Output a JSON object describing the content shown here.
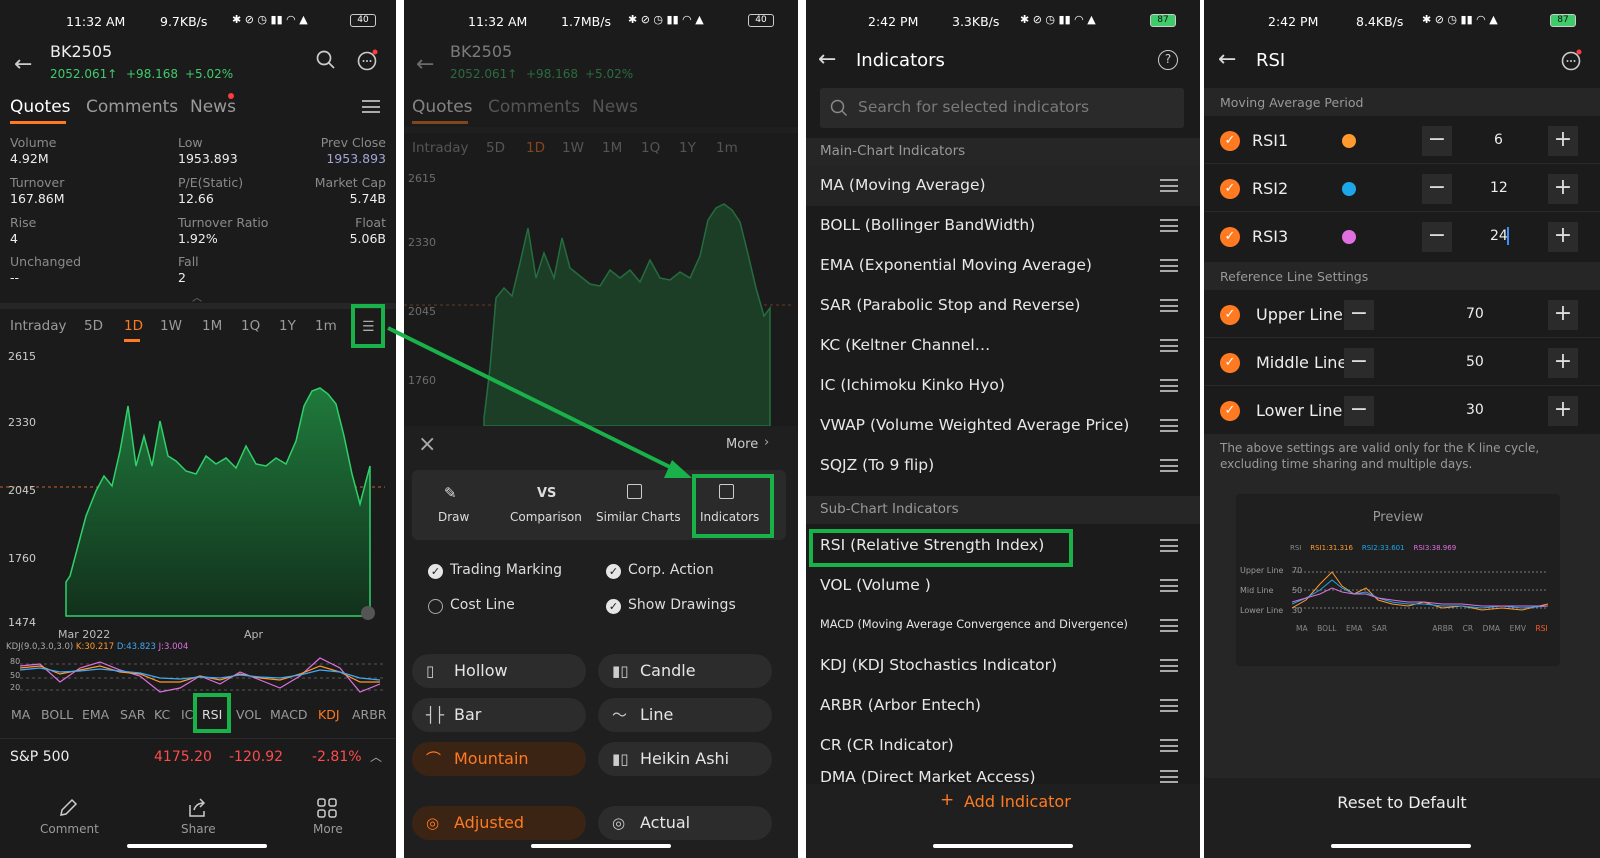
{
  "panel1": {
    "status": {
      "time": "11:32 AM",
      "speed": "9.7KB/s",
      "battery": "40"
    },
    "header": {
      "title": "BK2505",
      "price": "2052.061↑",
      "change": "+98.168",
      "pct": "+5.02%"
    },
    "tabs": [
      "Quotes",
      "Comments",
      "News"
    ],
    "stats": [
      {
        "label": "Volume",
        "value": "4.92M"
      },
      {
        "label": "Low",
        "value": "1953.893"
      },
      {
        "label": "Prev Close",
        "value": "1953.893"
      },
      {
        "label": "Turnover",
        "value": "167.86M"
      },
      {
        "label": "P/E(Static)",
        "value": "12.66"
      },
      {
        "label": "Market Cap",
        "value": "5.74B"
      },
      {
        "label": "Rise",
        "value": "4"
      },
      {
        "label": "Turnover Ratio",
        "value": "1.92%"
      },
      {
        "label": "Float",
        "value": "5.06B"
      },
      {
        "label": "Unchanged",
        "value": "--"
      },
      {
        "label": "Fall",
        "value": "2"
      }
    ],
    "periods": [
      "Intraday",
      "5D",
      "1D",
      "1W",
      "1M",
      "1Q",
      "1Y",
      "1m"
    ],
    "y_labels": [
      "2615",
      "2330",
      "2045",
      "1760",
      "1474"
    ],
    "x_labels": [
      "Mar 2022",
      "Apr"
    ],
    "kdj_legend": {
      "params": "KDJ(9.0,3.0,3.0)",
      "k": "K:30.217",
      "d": "D:43.823",
      "j": "J:3.004"
    },
    "kdj_levels": [
      "80",
      "50",
      "20"
    ],
    "indicators": [
      "MA",
      "BOLL",
      "EMA",
      "SAR",
      "KC",
      "IC",
      "RSI",
      "VOL",
      "MACD",
      "KDJ",
      "ARBR"
    ],
    "ticker": {
      "name": "S&P 500",
      "price": "4175.20",
      "change": "-120.92",
      "pct": "-2.81%"
    },
    "bottom": [
      "Comment",
      "Share",
      "More"
    ],
    "colors": {
      "up": "#3fca6b",
      "down": "#ff4b4b",
      "accent": "#ff7a20",
      "highlight": "#19b24a"
    }
  },
  "panel2": {
    "status": {
      "time": "11:32 AM",
      "speed": "1.7MB/s",
      "battery": "40"
    },
    "y_labels": [
      "2615",
      "2330",
      "2045",
      "1760"
    ],
    "more": "More",
    "tools": [
      "Draw",
      "Comparison",
      "Similar Charts",
      "Indicators"
    ],
    "vs_glyph": "VS",
    "options": [
      {
        "label": "Trading Marking",
        "checked": true
      },
      {
        "label": "Corp. Action",
        "checked": true
      },
      {
        "label": "Cost Line",
        "checked": false
      },
      {
        "label": "Show Drawings",
        "checked": true
      }
    ],
    "chart_types": [
      "Hollow",
      "Candle",
      "Bar",
      "Line",
      "Mountain",
      "Heikin Ashi"
    ],
    "bottom_row": [
      "Adjusted",
      "Actual"
    ]
  },
  "panel3": {
    "status": {
      "time": "2:42 PM",
      "speed": "3.3KB/s",
      "battery": "87"
    },
    "title": "Indicators",
    "help": "?",
    "search_placeholder": "Search for selected indicators",
    "main_header": "Main-Chart Indicators",
    "main_items": [
      "MA (Moving Average)",
      "BOLL (Bollinger BandWidth)",
      "EMA (Exponential Moving Average)",
      "SAR (Parabolic Stop and Reverse)",
      "KC (Keltner Channel…",
      "IC (Ichimoku Kinko Hyo)",
      "VWAP (Volume Weighted Average Price)",
      "SQJZ (To 9 flip)"
    ],
    "sub_header": "Sub-Chart Indicators",
    "sub_items": [
      "RSI (Relative Strength Index)",
      "VOL (Volume )",
      "MACD (Moving Average Convergence and Divergence)",
      "KDJ (KDJ Stochastics Indicator)",
      "ARBR (Arbor Entech)",
      "CR (CR Indicator)",
      "DMA (Direct Market Access)"
    ],
    "add_label": "Add Indicator"
  },
  "panel4": {
    "status": {
      "time": "2:42 PM",
      "speed": "8.4KB/s",
      "battery": "87"
    },
    "title": "RSI",
    "ma_header": "Moving Average Period",
    "rsi_rows": [
      {
        "label": "RSI1",
        "value": "6",
        "color": "#ff9a2e"
      },
      {
        "label": "RSI2",
        "value": "12",
        "color": "#1ea7e8"
      },
      {
        "label": "RSI3",
        "value": "24",
        "color": "#e070e0"
      }
    ],
    "ref_header": "Reference Line Settings",
    "ref_rows": [
      {
        "label": "Upper Line",
        "value": "70"
      },
      {
        "label": "Middle Line",
        "value": "50"
      },
      {
        "label": "Lower Line",
        "value": "30"
      }
    ],
    "note": "The above settings are valid only for the K line cycle, excluding time sharing and multiple days.",
    "preview": {
      "title": "Preview",
      "legend": [
        "RSI",
        "RSI1:31.316",
        "RSI2:33.601",
        "RSI3:38.969"
      ],
      "line_labels": [
        "Upper Line",
        "Mid Line",
        "Lower Line"
      ],
      "line_values": [
        "70",
        "50",
        "30"
      ],
      "tabs": [
        "MA",
        "BOLL",
        "EMA",
        "SAR",
        "ARBR",
        "CR",
        "DMA",
        "EMV",
        "RSI"
      ]
    },
    "reset": "Reset to Default"
  }
}
